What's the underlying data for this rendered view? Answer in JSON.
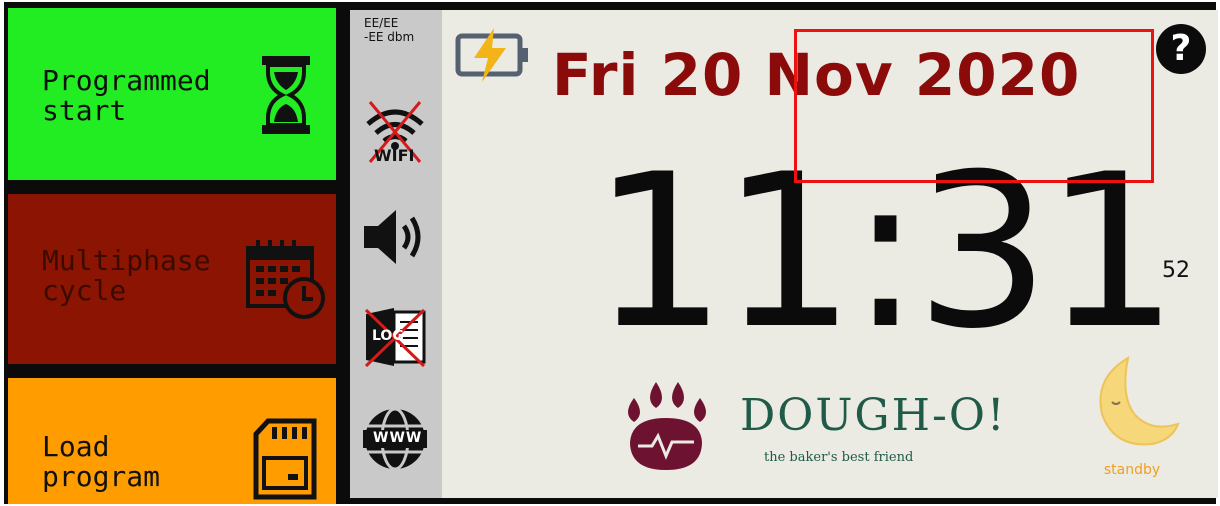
{
  "menu": {
    "programmed_start": "Programmed\nstart",
    "multiphase_cycle": "Multiphase\ncycle",
    "load_program": "Load\nprogram"
  },
  "status": {
    "signal": "EE/EE\n-EE dbm",
    "wifi_label": "WIFI",
    "log_label": "LOG",
    "web_label": "WWW"
  },
  "display": {
    "date": "Fri 20 Nov 2020",
    "time": "11:31",
    "seconds": "52",
    "help": "?"
  },
  "brand": {
    "name": "DOUGH-O!",
    "tagline": "the baker's best friend"
  },
  "standby": {
    "label": "standby"
  },
  "colors": {
    "programmed_start_bg": "#22ec22",
    "multiphase_bg": "#8c1402",
    "load_program_bg": "#ff9c00",
    "date_color": "#8b0b0b",
    "brand_color": "#1f5b48",
    "paw_color": "#6e1232",
    "highlight": "#ee1111"
  },
  "icons": {
    "programmed_start": "hourglass-icon",
    "multiphase_cycle": "calendar-clock-icon",
    "load_program": "sd-card-icon",
    "power": "battery-bolt-icon",
    "wifi": "wifi-off-icon",
    "sound": "speaker-icon",
    "log": "log-off-icon",
    "web": "globe-www-icon",
    "help": "help-icon",
    "standby": "moon-icon",
    "logo": "paw-icon"
  }
}
